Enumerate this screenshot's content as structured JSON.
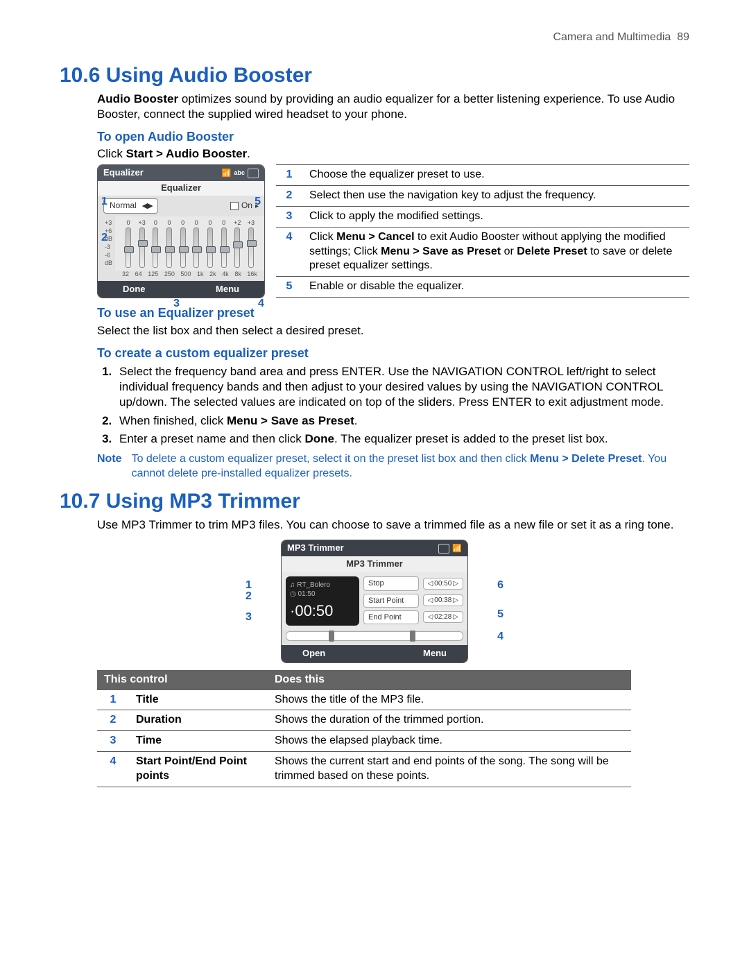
{
  "header": {
    "section": "Camera and Multimedia",
    "page": "89"
  },
  "s106": {
    "title": "10.6  Using Audio Booster",
    "intro_bold": "Audio Booster",
    "intro_rest": " optimizes sound by providing an audio equalizer for a better listening experience. To use Audio Booster, connect the supplied wired headset to your phone.",
    "open_h": "To open Audio Booster",
    "open_body_pre": "Click ",
    "open_body_bold": "Start > Audio Booster",
    "open_body_post": ".",
    "eq_ui": {
      "titlebar": "Equalizer",
      "sub": "Equalizer",
      "preset": "Normal",
      "on": "On",
      "levels": [
        "0",
        "+3",
        "0",
        "0",
        "0",
        "0",
        "0",
        "0",
        "+2",
        "+3"
      ],
      "db_labels": [
        "+3",
        "+6",
        "dB",
        "-3",
        "-6",
        "dB"
      ],
      "freqs": [
        "32",
        "64",
        "125",
        "250",
        "500",
        "1k",
        "2k",
        "4k",
        "8k",
        "16k"
      ],
      "done": "Done",
      "menu": "Menu"
    },
    "eq_callouts": [
      "1",
      "2",
      "3",
      "4",
      "5"
    ],
    "desc": [
      {
        "n": "1",
        "t": "Choose the equalizer preset to use."
      },
      {
        "n": "2",
        "t": "Select then use the navigation key to adjust the frequency."
      },
      {
        "n": "3",
        "t": "Click to apply the modified settings."
      },
      {
        "n": "4",
        "t": "Click Menu > Cancel to exit Audio Booster without applying the modified settings; Click Menu > Save as Preset or Delete Preset to save or delete preset equalizer settings."
      },
      {
        "n": "5",
        "t": "Enable or disable the equalizer."
      }
    ],
    "preset_h": "To use an Equalizer preset",
    "preset_body": "Select the list box and then select a desired preset.",
    "custom_h": "To create a custom equalizer preset",
    "steps": [
      "Select the frequency band area and press ENTER. Use the NAVIGATION CONTROL left/right to select individual frequency bands and then adjust to your desired values by using the NAVIGATION CONTROL up/down. The selected values are indicated on top of the sliders. Press ENTER to exit adjustment mode.",
      "When finished, click Menu > Save as Preset.",
      "Enter a preset name and then click Done. The equalizer preset is added to the preset list box."
    ],
    "note_label": "Note",
    "note_body": "To delete a custom equalizer preset, select it on the preset list box and then click Menu > Delete Preset. You cannot delete pre-installed equalizer presets."
  },
  "s107": {
    "title": "10.7  Using MP3 Trimmer",
    "intro": "Use MP3 Trimmer to trim MP3 files. You can choose to save a trimmed file as a new file or set it as a ring tone.",
    "ui": {
      "titlebar": "MP3 Trimmer",
      "sub": "MP3 Trimmer",
      "track": "RT_Bolero",
      "duration": "01:50",
      "time": "00:50",
      "stop": "Stop",
      "stop_val": "00:50",
      "sp": "Start Point",
      "sp_val": "00:38",
      "ep": "End Point",
      "ep_val": "02:28",
      "open": "Open",
      "menu": "Menu"
    },
    "callouts": [
      "1",
      "2",
      "3",
      "4",
      "5",
      "6"
    ],
    "table_head": [
      "This control",
      "Does this"
    ],
    "table": [
      {
        "n": "1",
        "name": "Title",
        "d": "Shows the title of the MP3 file."
      },
      {
        "n": "2",
        "name": "Duration",
        "d": "Shows the duration of the trimmed portion."
      },
      {
        "n": "3",
        "name": "Time",
        "d": "Shows the elapsed playback time."
      },
      {
        "n": "4",
        "name": "Start Point/End Point points",
        "d": "Shows the current start and end points of the song. The song will be trimmed based on these points."
      }
    ]
  }
}
